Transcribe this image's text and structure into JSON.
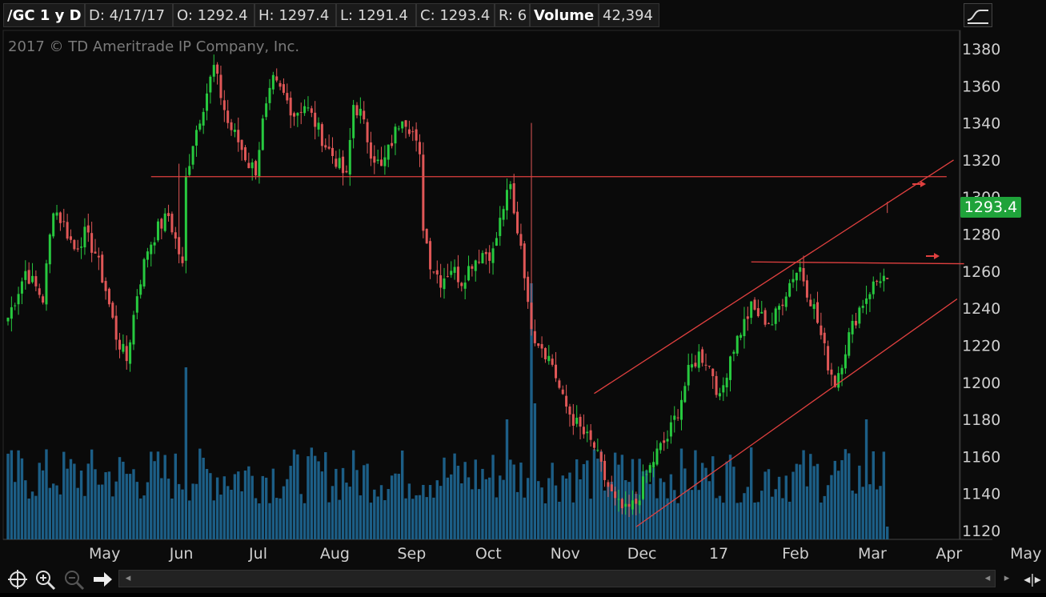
{
  "header": {
    "symbol": "/GC 1 y D",
    "date": "D: 4/17/17",
    "open": "O: 1292.4",
    "high": "H: 1297.4",
    "low": "L: 1291.4",
    "close": "C: 1293.4",
    "range": "R: 6",
    "volume_label": "Volume",
    "volume_value": "42,394"
  },
  "copyright": "2017 © TD Ameritrade IP Company, Inc.",
  "last_price_tag": "1293.4",
  "colors": {
    "up": "#27c93f",
    "down": "#e05757",
    "volume": "#1c5e86",
    "annotation": "#e0403f",
    "grid_text": "#cfcfcf",
    "price_tag": "#1fa33a"
  },
  "icons": [
    "study-icon",
    "crosshair-icon",
    "zoom-in-icon",
    "zoom-out-icon",
    "arrow-right-icon",
    "scroll-left-icon",
    "scroll-right-icon",
    "expand-icon"
  ],
  "chart_data": {
    "type": "candlestick",
    "ylim": [
      1115,
      1392
    ],
    "y_ticks": [
      1120,
      1140,
      1160,
      1180,
      1200,
      1220,
      1240,
      1260,
      1280,
      1300,
      1320,
      1340,
      1360,
      1380
    ],
    "x_labels": [
      "May",
      "Jun",
      "Jul",
      "Aug",
      "Sep",
      "Oct",
      "Nov",
      "Dec",
      "17",
      "Feb",
      "Mar",
      "Apr",
      "May"
    ],
    "x_label_index": [
      13,
      35,
      57,
      79,
      101,
      123,
      145,
      167,
      189,
      211,
      233,
      255,
      277
    ],
    "n_bars": 253,
    "anchors": [
      [
        0,
        1235
      ],
      [
        5,
        1260
      ],
      [
        10,
        1245
      ],
      [
        13,
        1295
      ],
      [
        16,
        1285
      ],
      [
        19,
        1272
      ],
      [
        22,
        1280
      ],
      [
        25,
        1270
      ],
      [
        28,
        1250
      ],
      [
        31,
        1225
      ],
      [
        34,
        1212
      ],
      [
        37,
        1248
      ],
      [
        40,
        1272
      ],
      [
        43,
        1283
      ],
      [
        46,
        1290
      ],
      [
        49,
        1270
      ],
      [
        50,
        1262
      ],
      [
        51,
        1310
      ],
      [
        53,
        1330
      ],
      [
        56,
        1350
      ],
      [
        59,
        1370
      ],
      [
        61,
        1355
      ],
      [
        63,
        1340
      ],
      [
        66,
        1330
      ],
      [
        69,
        1318
      ],
      [
        71,
        1315
      ],
      [
        73,
        1340
      ],
      [
        76,
        1362
      ],
      [
        79,
        1355
      ],
      [
        82,
        1345
      ],
      [
        85,
        1350
      ],
      [
        88,
        1340
      ],
      [
        91,
        1328
      ],
      [
        94,
        1320
      ],
      [
        97,
        1310
      ],
      [
        99,
        1350
      ],
      [
        101,
        1345
      ],
      [
        104,
        1325
      ],
      [
        107,
        1315
      ],
      [
        110,
        1330
      ],
      [
        113,
        1345
      ],
      [
        116,
        1335
      ],
      [
        118,
        1320
      ],
      [
        119,
        1285
      ],
      [
        121,
        1265
      ],
      [
        124,
        1255
      ],
      [
        127,
        1262
      ],
      [
        130,
        1255
      ],
      [
        133,
        1265
      ],
      [
        136,
        1270
      ],
      [
        139,
        1270
      ],
      [
        142,
        1295
      ],
      [
        144,
        1305
      ],
      [
        145,
        1290
      ],
      [
        147,
        1275
      ],
      [
        148,
        1260
      ],
      [
        149,
        1240
      ],
      [
        151,
        1225
      ],
      [
        153,
        1220
      ],
      [
        156,
        1210
      ],
      [
        159,
        1190
      ],
      [
        162,
        1180
      ],
      [
        165,
        1172
      ],
      [
        168,
        1165
      ],
      [
        171,
        1148
      ],
      [
        174,
        1135
      ],
      [
        177,
        1130
      ],
      [
        180,
        1135
      ],
      [
        183,
        1150
      ],
      [
        186,
        1162
      ],
      [
        189,
        1170
      ],
      [
        192,
        1185
      ],
      [
        195,
        1205
      ],
      [
        198,
        1215
      ],
      [
        200,
        1212
      ],
      [
        202,
        1205
      ],
      [
        204,
        1190
      ],
      [
        207,
        1215
      ],
      [
        210,
        1228
      ],
      [
        213,
        1240
      ],
      [
        216,
        1235
      ],
      [
        219,
        1232
      ],
      [
        222,
        1245
      ],
      [
        225,
        1258
      ],
      [
        227,
        1262
      ],
      [
        229,
        1250
      ],
      [
        231,
        1240
      ],
      [
        233,
        1225
      ],
      [
        235,
        1210
      ],
      [
        237,
        1200
      ],
      [
        239,
        1212
      ],
      [
        241,
        1225
      ],
      [
        244,
        1240
      ],
      [
        247,
        1250
      ],
      [
        250,
        1257
      ],
      [
        253,
        1255
      ],
      [
        256,
        1262
      ],
      [
        258,
        1275
      ],
      [
        260,
        1290
      ],
      [
        262,
        1293.4
      ]
    ],
    "annotations": {
      "resistance": {
        "x1": 41,
        "y1": 1311,
        "x2": 269,
        "y2": 1311
      },
      "support": {
        "x1": 213,
        "y1": 1265,
        "x2": 274,
        "y2": 1264
      },
      "channel_upper": {
        "x1": 168,
        "y1": 1194,
        "x2": 271,
        "y2": 1320
      },
      "channel_lower": {
        "x1": 180,
        "y1": 1122,
        "x2": 272,
        "y2": 1245
      }
    }
  }
}
